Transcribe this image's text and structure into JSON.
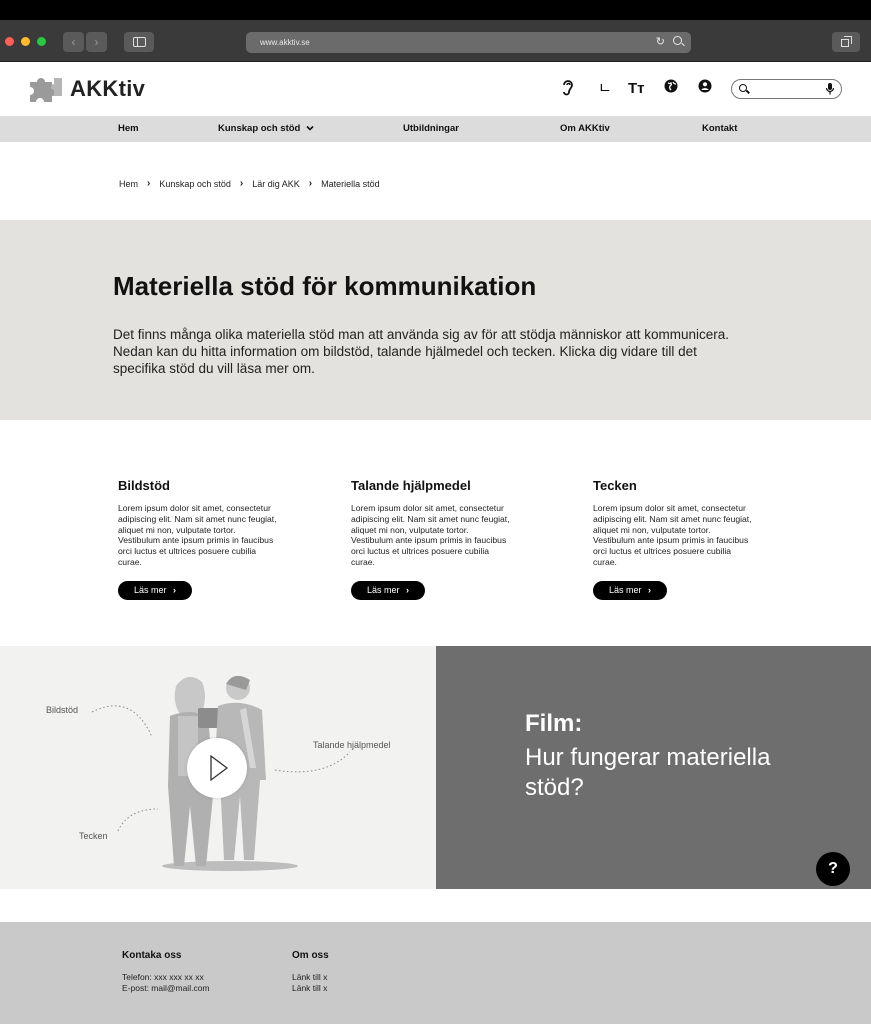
{
  "browser": {
    "url": "www.akktiv.se"
  },
  "header": {
    "logo_text": "AKKtiv",
    "tools": {
      "text_size_label": "Tт",
      "sign_label": "ㄴ"
    },
    "search": {
      "placeholder": ""
    }
  },
  "nav": {
    "items": [
      {
        "label": "Hem"
      },
      {
        "label": "Kunskap och stöd"
      },
      {
        "label": "Utbildningar"
      },
      {
        "label": "Om AKKtiv"
      },
      {
        "label": "Kontakt"
      }
    ]
  },
  "breadcrumb": [
    "Hem",
    "Kunskap och stöd",
    "Lär dig AKK",
    "Materiella stöd"
  ],
  "hero": {
    "title": "Materiella stöd för kommunikation",
    "text": "Det finns många olika materiella stöd man att använda sig av för att stödja människor att kommunicera. Nedan kan du hitta information om bildstöd, talande hjälmedel och tecken. Klicka dig vidare till det specifika stöd du vill läsa mer om."
  },
  "cards": [
    {
      "title": "Bildstöd",
      "text": "Lorem ipsum dolor sit amet, consectetur adipiscing elit. Nam sit amet nunc feugiat, aliquet mi non, vulputate tortor. Vestibulum ante ipsum primis in faucibus orci luctus et ultrices posuere cubilia curae.",
      "button": "Läs mer"
    },
    {
      "title": "Talande hjälpmedel",
      "text": "Lorem ipsum dolor sit amet, consectetur adipiscing elit. Nam sit amet nunc feugiat, aliquet mi non, vulputate tortor. Vestibulum ante ipsum primis in faucibus orci luctus et ultrices posuere cubilia curae.",
      "button": "Läs mer"
    },
    {
      "title": "Tecken",
      "text": "Lorem ipsum dolor sit amet, consectetur adipiscing elit. Nam sit amet nunc feugiat, aliquet mi non, vulputate tortor. Vestibulum ante ipsum primis in faucibus orci luctus et ultrices posuere cubilia curae.",
      "button": "Läs mer"
    }
  ],
  "video": {
    "labels": {
      "bildstod": "Bildstöd",
      "talande": "Talande hjälpmedel",
      "tecken": "Tecken"
    },
    "film_title": "Film:",
    "film_subtitle": "Hur fungerar materiella stöd?",
    "help_label": "?"
  },
  "footer": {
    "contact": {
      "title": "Kontaka oss",
      "phone": "Telefon: xxx xxx xx xx",
      "email": "E-post: mail@mail.com"
    },
    "about": {
      "title": "Om oss",
      "links": [
        "Länk till x",
        "Länk till x"
      ]
    }
  },
  "colors": {
    "nav_bg": "#dcdcdc",
    "hero_bg": "#e3e2df",
    "video_panel": "#6e6e6e",
    "footer_bg": "#c9c9c9",
    "button": "#000000"
  }
}
